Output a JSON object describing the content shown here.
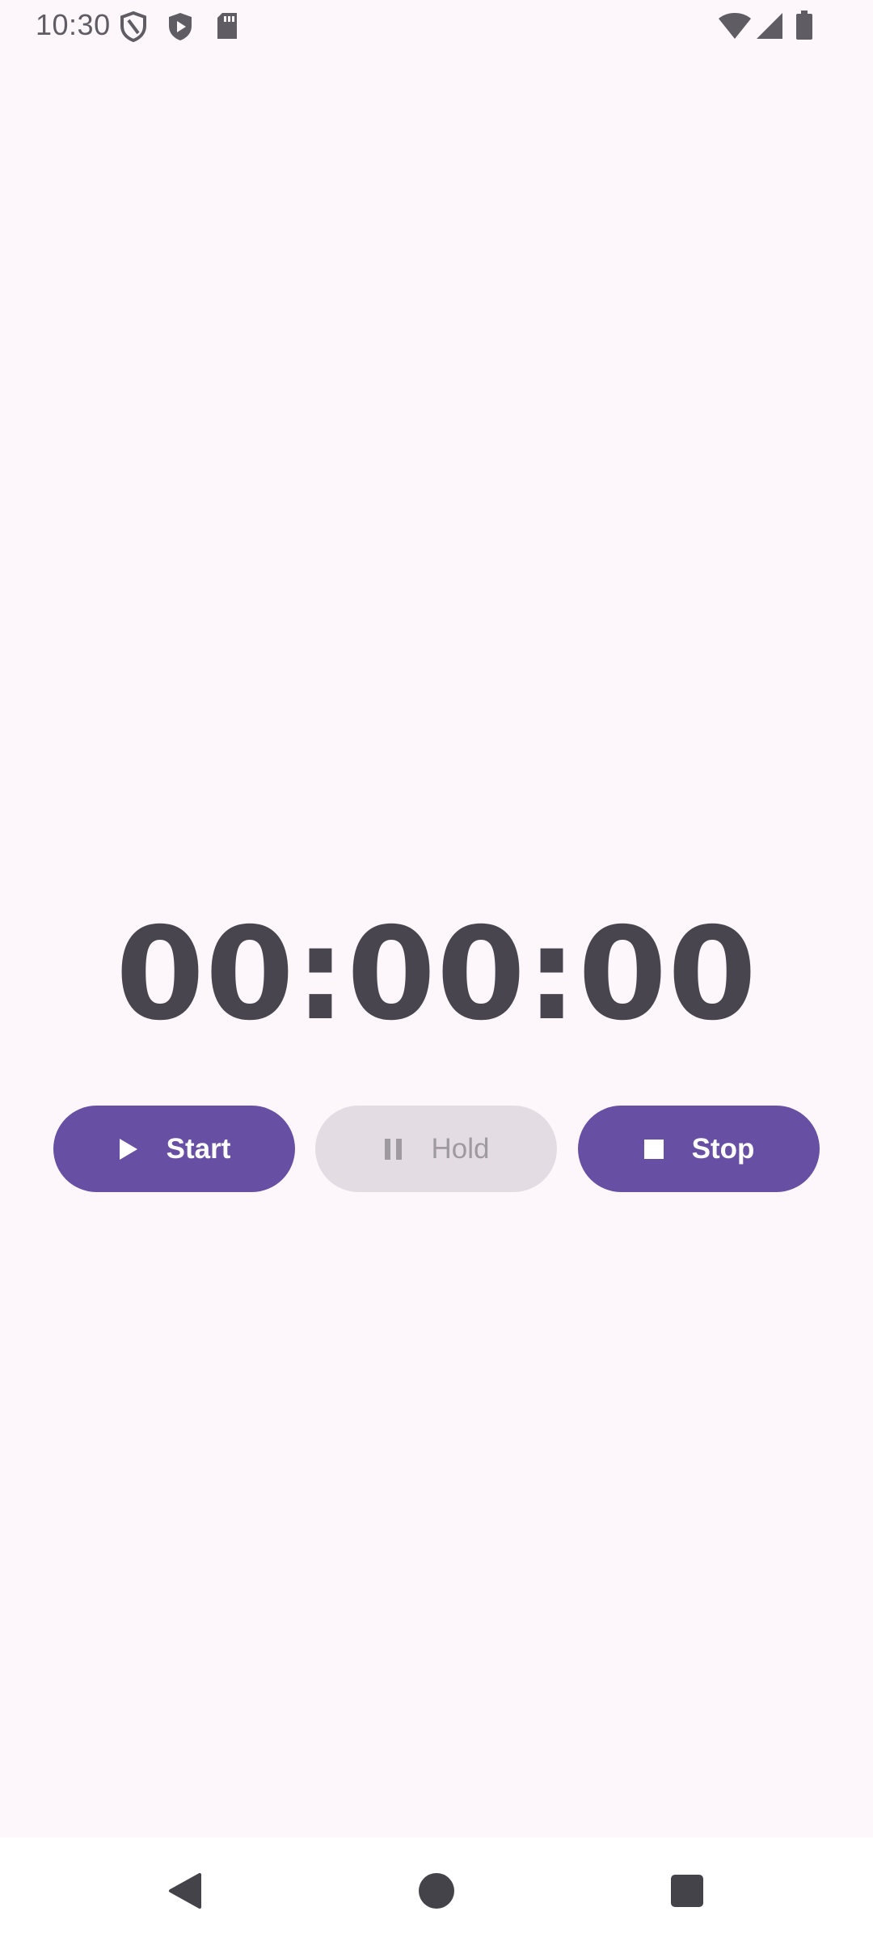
{
  "status_bar": {
    "time": "10:30",
    "left_icons": [
      "shield-outline-icon",
      "shield-play-icon",
      "sd-card-icon"
    ],
    "right_icons": [
      "wifi-icon",
      "signal-icon",
      "battery-icon"
    ]
  },
  "timer": {
    "display": "00:00:00"
  },
  "controls": {
    "start_label": "Start",
    "hold_label": "Hold",
    "stop_label": "Stop"
  },
  "colors": {
    "background": "#fdf7fc",
    "primary": "#6750a4",
    "disabled_bg": "#e3dde3",
    "disabled_text": "#9e9aa0",
    "timer_text": "#49454f"
  },
  "nav_bar": {
    "icons": [
      "back-icon",
      "home-icon",
      "recents-icon"
    ]
  }
}
